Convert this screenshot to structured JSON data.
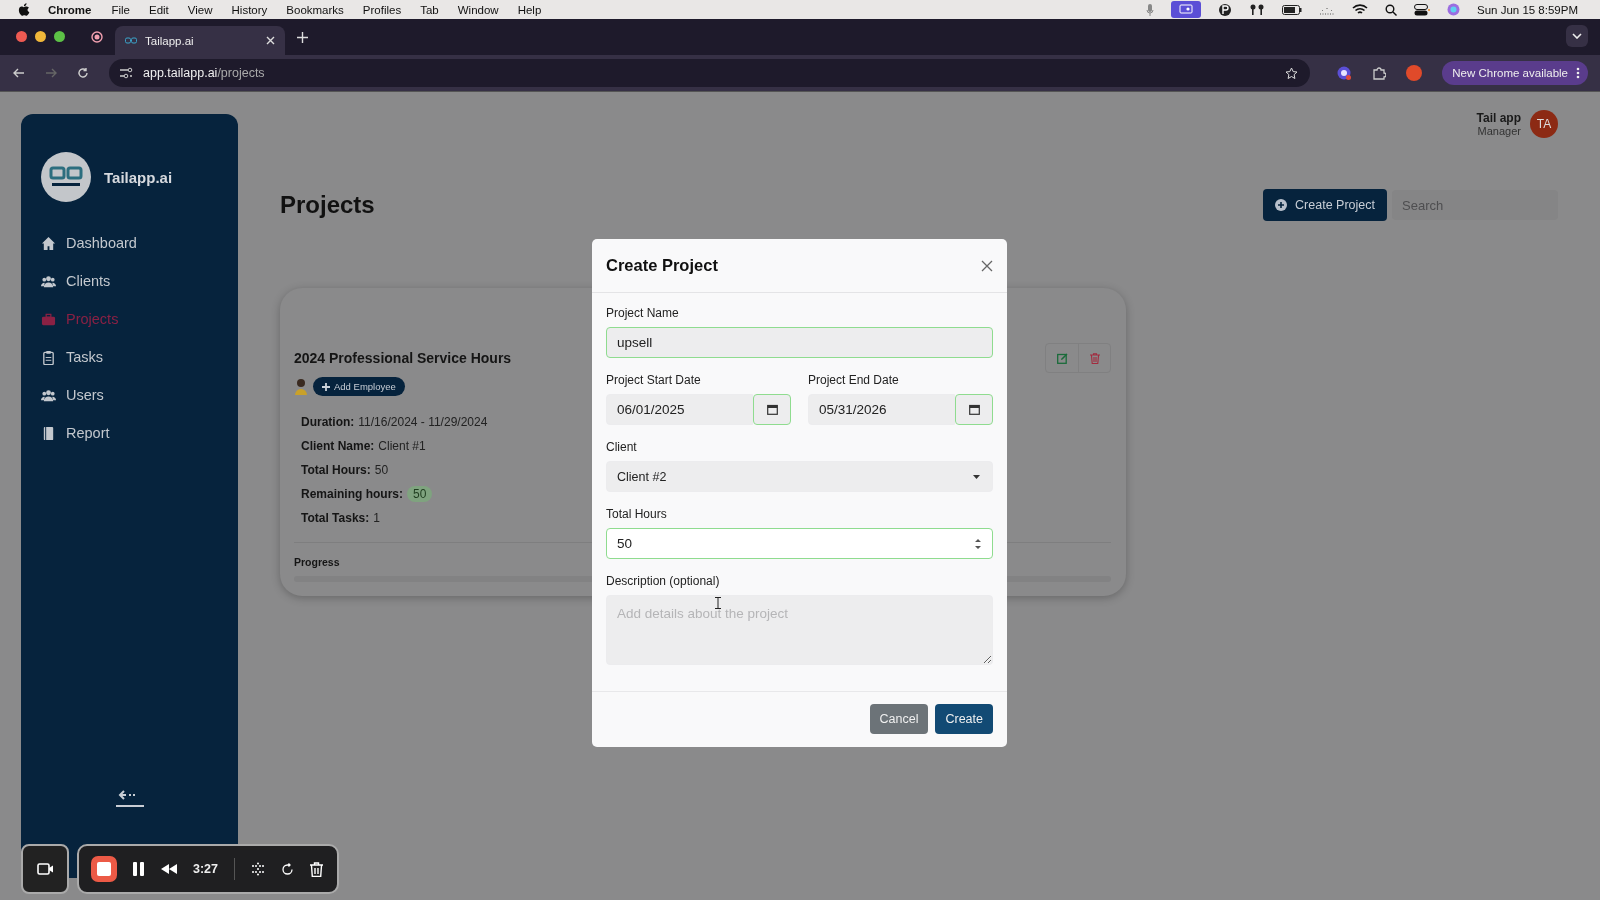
{
  "menubar": {
    "app": "Chrome",
    "menus": [
      "File",
      "Edit",
      "View",
      "History",
      "Bookmarks",
      "Profiles",
      "Tab",
      "Window",
      "Help"
    ],
    "clock": "Sun Jun 15 8:59PM"
  },
  "browser": {
    "tab": {
      "title": "Tailapp.ai"
    },
    "url_host": "app.tailapp.ai",
    "url_path": "/projects",
    "update_button": "New Chrome available"
  },
  "sidebar": {
    "brand": "Tailapp.ai",
    "items": [
      {
        "label": "Dashboard",
        "selected": false
      },
      {
        "label": "Clients",
        "selected": false
      },
      {
        "label": "Projects",
        "selected": true
      },
      {
        "label": "Tasks",
        "selected": false
      },
      {
        "label": "Users",
        "selected": false
      },
      {
        "label": "Report",
        "selected": false
      }
    ]
  },
  "user": {
    "name": "Tail app",
    "role": "Manager",
    "initials": "TA"
  },
  "page": {
    "title": "Projects",
    "create_button": "Create Project",
    "search": {
      "placeholder": "Search"
    }
  },
  "project_card": {
    "title": "2024 Professional Service Hours",
    "add_employee": "Add Employee",
    "details": [
      {
        "label": "Duration:",
        "value": "11/16/2024 - 11/29/2024",
        "kind": "text"
      },
      {
        "label": "Client Name:",
        "value": "Client #1",
        "kind": "text"
      },
      {
        "label": "Total Hours:",
        "value": "50",
        "kind": "text"
      },
      {
        "label": "Remaining hours:",
        "value": "50",
        "kind": "badge"
      },
      {
        "label": "Total Tasks:",
        "value": "1",
        "kind": "text"
      }
    ],
    "progress_label": "Progress",
    "progress": {
      "level": 0
    }
  },
  "modal": {
    "title": "Create Project",
    "fields": [
      {
        "kind": "text",
        "label": "Project Name",
        "value": "upsell",
        "valid": true
      },
      {
        "kind": "date",
        "label": "Project Start Date",
        "value": "06/01/2025",
        "valid": true
      },
      {
        "kind": "date",
        "label": "Project End Date",
        "value": "05/31/2026",
        "valid": true
      },
      {
        "kind": "select",
        "label": "Client",
        "value": "Client #2",
        "valid": false
      },
      {
        "kind": "number",
        "label": "Total Hours",
        "value": "50",
        "valid": true
      },
      {
        "kind": "textarea",
        "label": "Description (optional)",
        "placeholder": "Add details about the project",
        "valid": false
      }
    ],
    "buttons": [
      {
        "label": "Cancel",
        "kind": "secondary"
      },
      {
        "label": "Create",
        "kind": "primary"
      }
    ]
  },
  "recorder": {
    "time": "3:27"
  }
}
